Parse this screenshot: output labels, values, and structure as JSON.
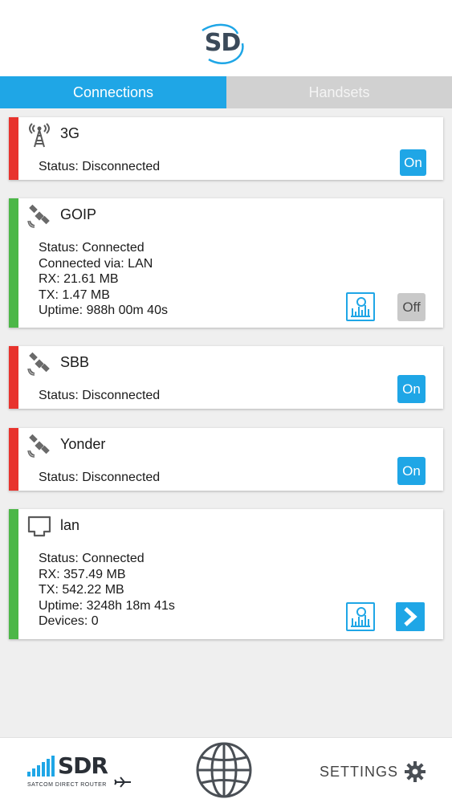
{
  "app": {
    "logo_text": "SD",
    "tabs": [
      {
        "label": "Connections",
        "active": true
      },
      {
        "label": "Handsets",
        "active": false
      }
    ],
    "colors": {
      "accent": "#1fa6e6",
      "disconnected": "#e8332d",
      "connected": "#4cb748"
    }
  },
  "connections": [
    {
      "name": "3G",
      "icon": "cell-tower-icon",
      "state": "disconnected",
      "lines": [
        "Status: Disconnected"
      ],
      "toggle_label": "On",
      "toggle_state": "on"
    },
    {
      "name": "GOIP",
      "icon": "satellite-icon",
      "state": "connected",
      "lines": [
        "Status: Connected",
        "Connected via: LAN",
        "RX: 21.61 MB",
        "TX: 1.47 MB",
        "Uptime: 988h 00m 40s"
      ],
      "toggle_label": "Off",
      "toggle_state": "off"
    },
    {
      "name": "SBB",
      "icon": "satellite-icon",
      "state": "disconnected",
      "lines": [
        "Status: Disconnected"
      ],
      "toggle_label": "On",
      "toggle_state": "on"
    },
    {
      "name": "Yonder",
      "icon": "satellite-icon",
      "state": "disconnected",
      "lines": [
        "Status: Disconnected"
      ],
      "toggle_label": "On",
      "toggle_state": "on"
    },
    {
      "name": "lan",
      "icon": "ethernet-port-icon",
      "state": "connected",
      "lines": [
        "Status: Connected",
        "RX: 357.49 MB",
        "TX: 542.22 MB",
        "Uptime: 3248h 18m 41s",
        "Devices: 0"
      ]
    }
  ],
  "footer": {
    "sdr_logo_text": "SDR",
    "sdr_subtitle": "SATCOM DIRECT ROUTER",
    "settings_label": "SETTINGS"
  }
}
